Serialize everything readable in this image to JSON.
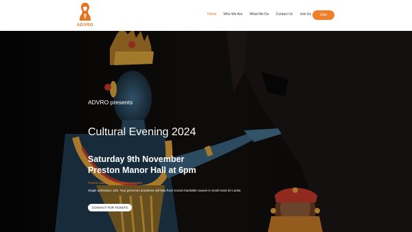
{
  "header": {
    "logo_text": "ADVRO",
    "nav": [
      "Home",
      "Who We Are",
      "What We Do",
      "Contact Us",
      "Join Us"
    ],
    "active_nav": "Home",
    "donate_label": "Give"
  },
  "hero": {
    "presents": "ADVRO presents",
    "title": "Cultural Evening 2024",
    "date_line": "Saturday 9th November",
    "venue_line": "Preston Manor Hall at 6pm",
    "address": "Preston Manor Hall, Wembley HA9 8NA",
    "admission": "Single admission: £25. Your generous donations will help fund crucial charitable causes in South East Sri Lanka",
    "contact_label": "CONTACT FOR TICKETS"
  },
  "colors": {
    "accent": "#e3731f",
    "button": "#f07f2c",
    "hero_bg": "#0e0c0b"
  }
}
